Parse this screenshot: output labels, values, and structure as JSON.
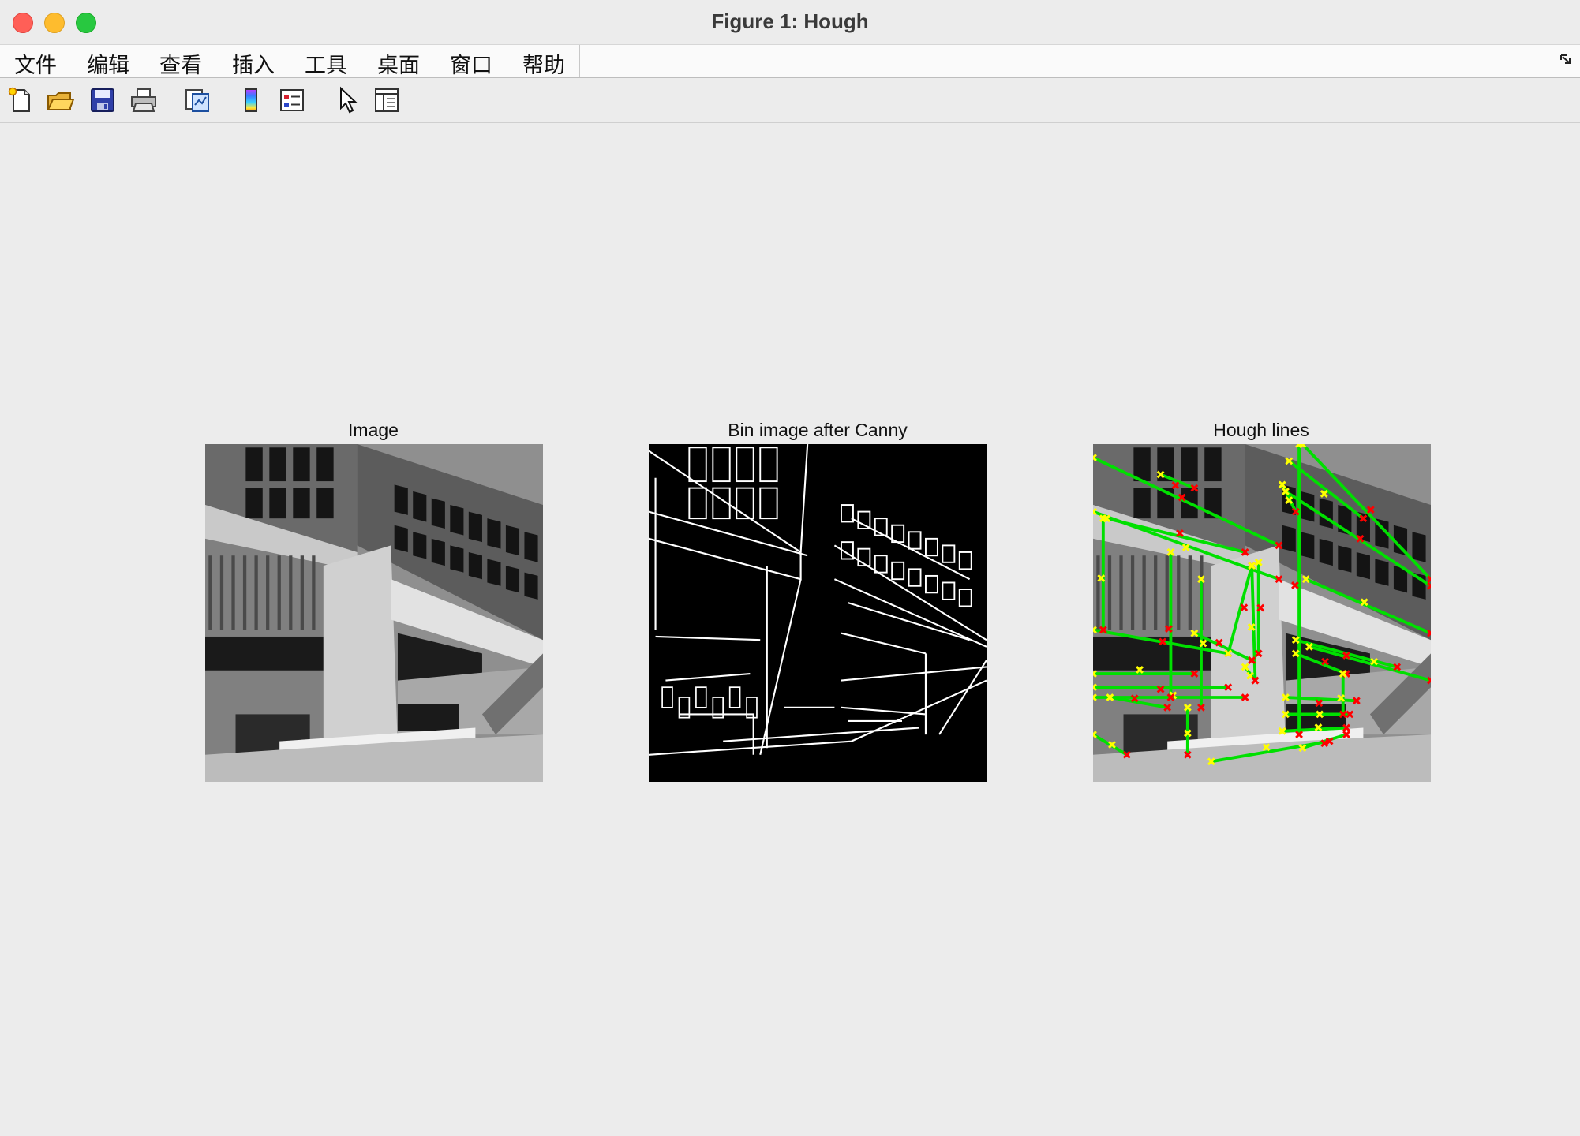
{
  "window": {
    "title": "Figure 1: Hough"
  },
  "menu": {
    "items": [
      "文件",
      "编辑",
      "查看",
      "插入",
      "工具",
      "桌面",
      "窗口",
      "帮助"
    ]
  },
  "toolbar": {
    "buttons": [
      {
        "icon": "new-figure-icon"
      },
      {
        "icon": "open-folder-icon"
      },
      {
        "icon": "save-icon"
      },
      {
        "icon": "print-icon"
      },
      {
        "icon": "link-plot-icon"
      },
      {
        "icon": "colorbar-icon"
      },
      {
        "icon": "legend-icon"
      },
      {
        "icon": "pointer-icon"
      },
      {
        "icon": "property-editor-icon"
      }
    ]
  },
  "axes": [
    {
      "title": "Image"
    },
    {
      "title": "Bin image after Canny"
    },
    {
      "title": "Hough lines"
    }
  ],
  "colors": {
    "line": "#00e000",
    "start_marker": "#ffff00",
    "end_marker": "#ff0000"
  }
}
